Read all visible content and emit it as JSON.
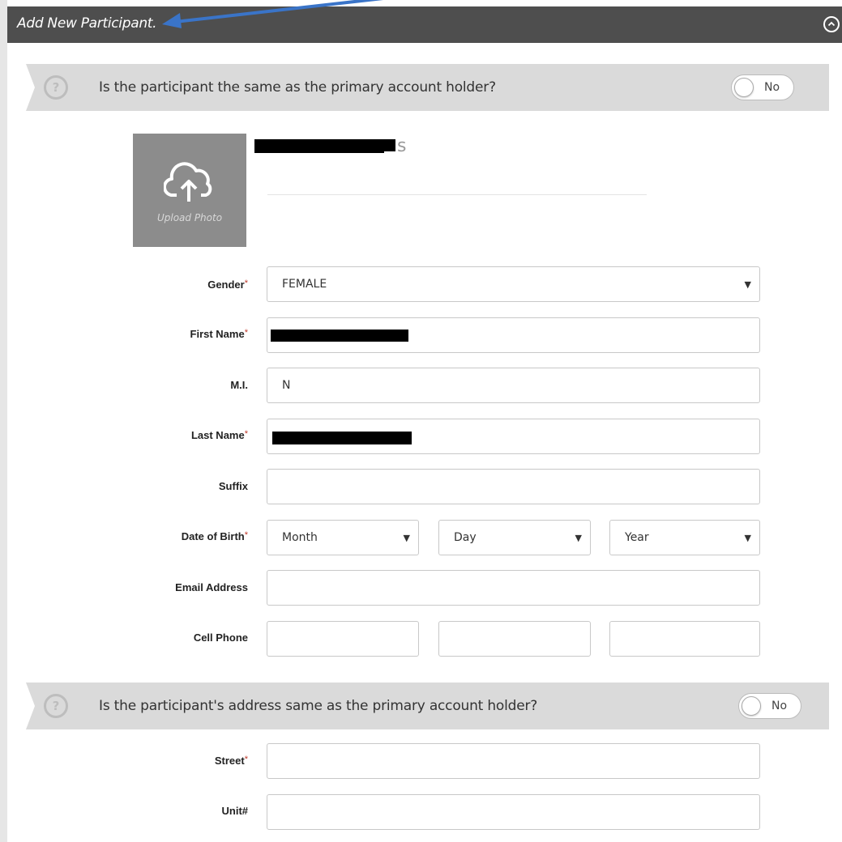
{
  "header": {
    "title": "Add New Participant."
  },
  "banner1": {
    "question": "Is the participant the same as the primary account holder?",
    "toggle_label": "No"
  },
  "photo": {
    "label": "Upload Photo"
  },
  "participant": {
    "name_visible": "s"
  },
  "form": {
    "gender": {
      "label": "Gender",
      "value": "FEMALE"
    },
    "first_name": {
      "label": "First Name",
      "value": ""
    },
    "mi": {
      "label": "M.I.",
      "value": "N"
    },
    "last_name": {
      "label": "Last Name",
      "value": ""
    },
    "suffix": {
      "label": "Suffix",
      "value": ""
    },
    "dob": {
      "label": "Date of Birth",
      "month": "Month",
      "day": "Day",
      "year": "Year"
    },
    "email": {
      "label": "Email Address",
      "value": ""
    },
    "cell": {
      "label": "Cell Phone"
    },
    "street": {
      "label": "Street",
      "value": ""
    },
    "unit": {
      "label": "Unit#",
      "value": ""
    }
  },
  "banner2": {
    "question": "Is the participant's address same as the primary account holder?",
    "toggle_label": "No"
  },
  "icons": {
    "collapse": "chevron-up-circle-icon",
    "help": "question-circle-icon",
    "upload": "cloud-upload-icon",
    "dropdown": "caret-down-icon"
  },
  "colors": {
    "header_bg": "#4e4e4e",
    "banner_bg": "#dadada",
    "photo_bg": "#8c8c8c",
    "arrow": "#3a74c8",
    "required": "#c0392b"
  }
}
